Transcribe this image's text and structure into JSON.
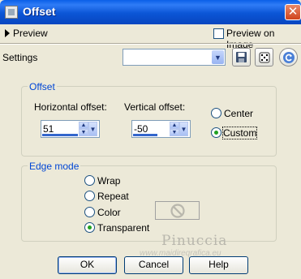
{
  "window": {
    "title": "Offset",
    "close_glyph": "✕"
  },
  "preview": {
    "label": "Preview",
    "on_image_label": "Preview on Image",
    "on_image_checked": false
  },
  "settings": {
    "label": "Settings",
    "preset_value": ""
  },
  "offset": {
    "group_title": "Offset",
    "horizontal_label": "Horizontal offset:",
    "horizontal_value": "51",
    "vertical_label": "Vertical offset:",
    "vertical_value": "-50",
    "origin_options": [
      {
        "label": "Center",
        "selected": false
      },
      {
        "label": "Custom",
        "selected": true
      }
    ]
  },
  "edge_mode": {
    "group_title": "Edge mode",
    "options": [
      {
        "label": "Wrap",
        "selected": false
      },
      {
        "label": "Repeat",
        "selected": false
      },
      {
        "label": "Color",
        "selected": false
      },
      {
        "label": "Transparent",
        "selected": true
      }
    ]
  },
  "buttons": {
    "ok": "OK",
    "cancel": "Cancel",
    "help": "Help"
  },
  "watermark": {
    "name": "Pinuccia",
    "url": "www.maidireqrafica.eu"
  },
  "colors": {
    "accent_blue": "#0046d5",
    "titlebar": "#0b55d6",
    "dialog_bg": "#ece9d8"
  },
  "icons": [
    "app-icon",
    "save-preset-icon",
    "randomize-icon",
    "reset-icon",
    "no-color-icon"
  ]
}
